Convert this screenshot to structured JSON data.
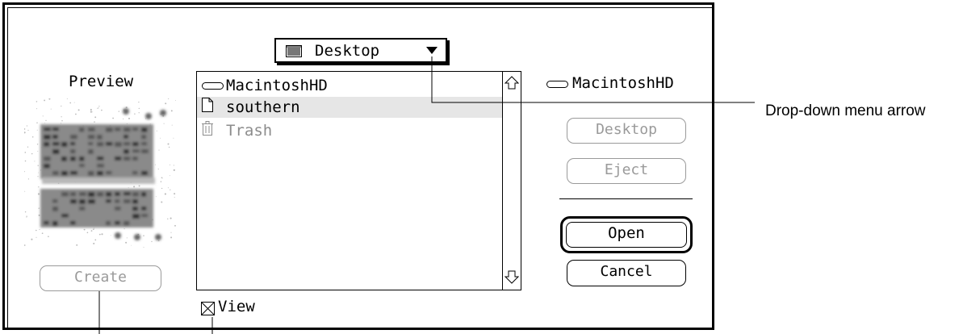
{
  "popup": {
    "icon": "desktop-icon",
    "label": "Desktop"
  },
  "preview": {
    "label": "Preview",
    "create_label": "Create"
  },
  "file_list": {
    "items": [
      {
        "icon": "disk-icon",
        "name": "MacintoshHD",
        "selected": false,
        "dimmed": false
      },
      {
        "icon": "document-icon",
        "name": "southern",
        "selected": true,
        "dimmed": false
      },
      {
        "icon": "trash-icon",
        "name": "Trash",
        "selected": false,
        "dimmed": true
      }
    ]
  },
  "view_checkbox": {
    "label": "View",
    "checked": true
  },
  "volume": {
    "icon": "disk-icon",
    "name": "MacintoshHD"
  },
  "buttons": {
    "desktop": "Desktop",
    "eject": "Eject",
    "open": "Open",
    "cancel": "Cancel"
  },
  "callout": {
    "label": "Drop-down menu arrow"
  }
}
